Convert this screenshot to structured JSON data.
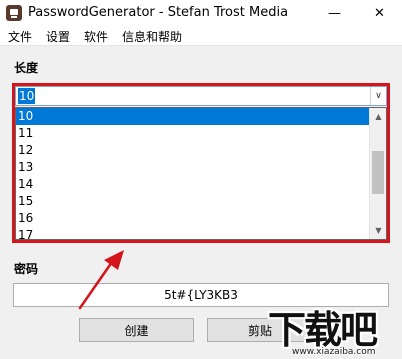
{
  "window": {
    "title": "PasswordGenerator - Stefan Trost Media",
    "minimize_glyph": "—",
    "close_glyph": "✕"
  },
  "menu": [
    "文件",
    "设置",
    "软件",
    "信息和帮助"
  ],
  "length": {
    "label": "长度",
    "selected": "10",
    "options": [
      "10",
      "11",
      "12",
      "13",
      "14",
      "15",
      "16",
      "17"
    ],
    "scroll_up_glyph": "▲",
    "scroll_down_glyph": "▼",
    "dropdown_glyph": "∨"
  },
  "password": {
    "label": "密码",
    "value": "5t#{LY3KB3"
  },
  "buttons": {
    "create": "创建",
    "copy": "剪贴"
  },
  "watermark": {
    "main": "下载吧",
    "url": "www.xiazaiba.com"
  },
  "colors": {
    "highlight": "#d4151b",
    "selection": "#0078d7",
    "arrow": "#d4151b"
  }
}
